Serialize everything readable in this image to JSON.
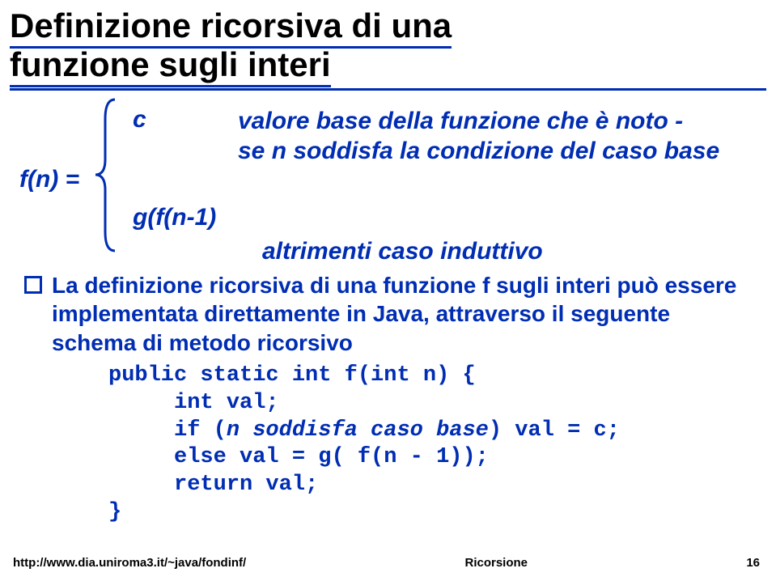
{
  "title_l1": "Definizione ricorsiva di una",
  "title_l2": "funzione sugli interi",
  "def": {
    "lhs": "f(n) =",
    "c_sym": "c",
    "c_desc_l1": "valore base della funzione che è noto -",
    "c_desc_l2": "se n soddisfa la condizione del caso base",
    "g_sym": "g(f(n-1)",
    "g_desc": "altrimenti caso induttivo"
  },
  "para": "La definizione ricorsiva di una funzione f sugli interi può essere implementata direttamente in Java, attraverso il seguente schema di metodo ricorsivo",
  "code": {
    "l1a": "public static int f(int n) {",
    "l2a": "     int val;",
    "l3a": "     if (",
    "l3b": "n soddisfa caso base",
    "l3c": ") val = c;",
    "l4a": "     else val = g( f(n - 1));",
    "l5a": "     return val;",
    "l6a": "}"
  },
  "footer": {
    "left": "http://www.dia.uniroma3.it/~java/fondinf/",
    "center": "Ricorsione",
    "right": "16"
  }
}
